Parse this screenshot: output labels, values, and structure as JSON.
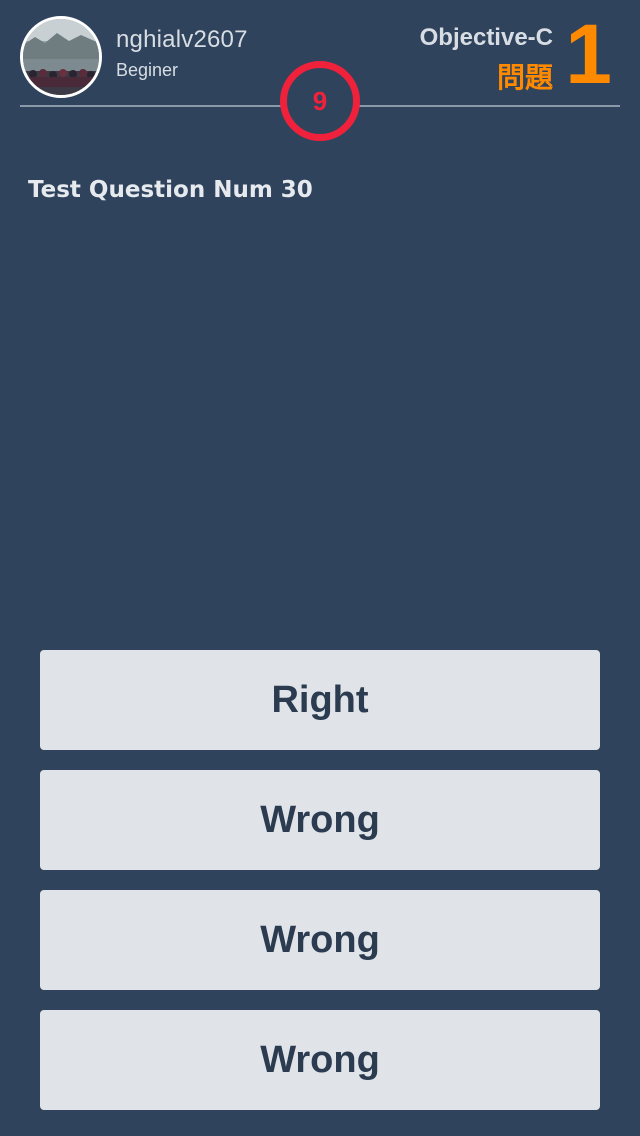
{
  "user": {
    "name": "nghialv2607",
    "level": "Beginer"
  },
  "quiz": {
    "category": "Objective-C",
    "question_word": "問題",
    "question_number": "1",
    "timer_seconds": "9"
  },
  "question": {
    "text": "Test Question Num 30"
  },
  "answers": [
    {
      "label": "Right"
    },
    {
      "label": "Wrong"
    },
    {
      "label": "Wrong"
    },
    {
      "label": "Wrong"
    }
  ],
  "colors": {
    "background": "#2f435c",
    "accent_orange": "#ff8a00",
    "timer_red": "#f0223b",
    "button_bg": "#e0e3e8",
    "button_text": "#2b3b50"
  },
  "icons": {
    "avatar": "user-avatar-photo",
    "timer": "countdown-circle-icon"
  }
}
